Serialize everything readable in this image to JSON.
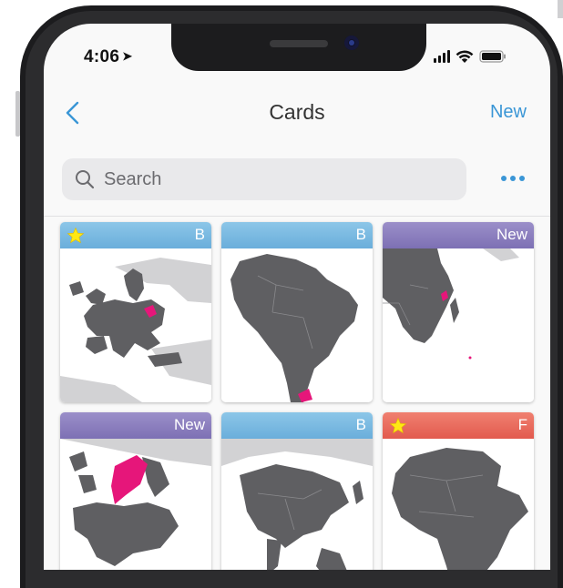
{
  "status_bar": {
    "time": "4:06"
  },
  "nav": {
    "title": "Cards",
    "new_label": "New"
  },
  "search": {
    "placeholder": "Search"
  },
  "cards": [
    {
      "badge": "B",
      "header_color": "#6aaedb",
      "starred": true,
      "map": "Europe"
    },
    {
      "badge": "B",
      "header_color": "#6aaedb",
      "starred": false,
      "map": "South America"
    },
    {
      "badge": "New",
      "header_color": "#7d70b4",
      "starred": false,
      "map": "Africa and Indian Ocean"
    },
    {
      "badge": "New",
      "header_color": "#7d70b4",
      "starred": false,
      "map": "Scandinavia"
    },
    {
      "badge": "B",
      "header_color": "#6aaedb",
      "starred": false,
      "map": "Asia"
    },
    {
      "badge": "F",
      "header_color": "#e25a4e",
      "starred": true,
      "map": "Africa"
    }
  ],
  "colors": {
    "accent": "#3a96d6",
    "land": "#5f5f62",
    "highlight": "#e6167a",
    "other_land": "#d2d2d4"
  },
  "icons": [
    "back-chevron-icon",
    "search-icon",
    "more-dots-icon",
    "star-icon",
    "signal-icon",
    "wifi-icon",
    "battery-icon",
    "location-arrow-icon"
  ]
}
